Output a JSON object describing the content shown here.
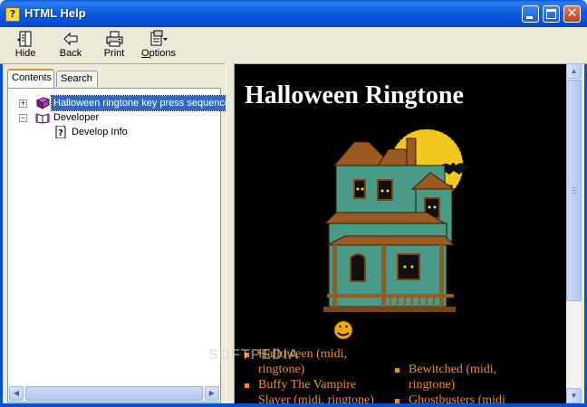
{
  "window": {
    "title": "HTML Help"
  },
  "toolbar": {
    "buttons": [
      {
        "label": "Hide",
        "icon": "hide-pane-icon"
      },
      {
        "label": "Back",
        "icon": "back-arrow-icon"
      },
      {
        "label": "Print",
        "icon": "printer-icon"
      },
      {
        "label": "Options",
        "icon": "options-icon"
      }
    ]
  },
  "nav": {
    "tabs": [
      {
        "label": "Contents",
        "active": true
      },
      {
        "label": "Search",
        "active": false
      }
    ],
    "tree": [
      {
        "label": "Halloween ringtone key press sequence",
        "icon": "book-closed-icon",
        "expander": "+",
        "selected": true
      },
      {
        "label": "Developer",
        "icon": "book-open-icon",
        "expander": "−",
        "selected": false
      },
      {
        "label": "Develop Info",
        "icon": "help-page-icon",
        "expander": "",
        "selected": false
      }
    ]
  },
  "content": {
    "title": "Halloween Ringtone",
    "list_left": [
      "Halloween (midi, ringtone)",
      "Buffy The Vampire Slayer (midi, ringtone)"
    ],
    "list_right": [
      "Bewitched (midi, ringtone)",
      "Ghostbusters (midi"
    ],
    "watermark": "SOFTPEDIA",
    "text_color": "#f28c10"
  },
  "colors": {
    "titlebar": "#0b5ce0",
    "selection": "#316ac5",
    "content_bg": "#000000"
  }
}
